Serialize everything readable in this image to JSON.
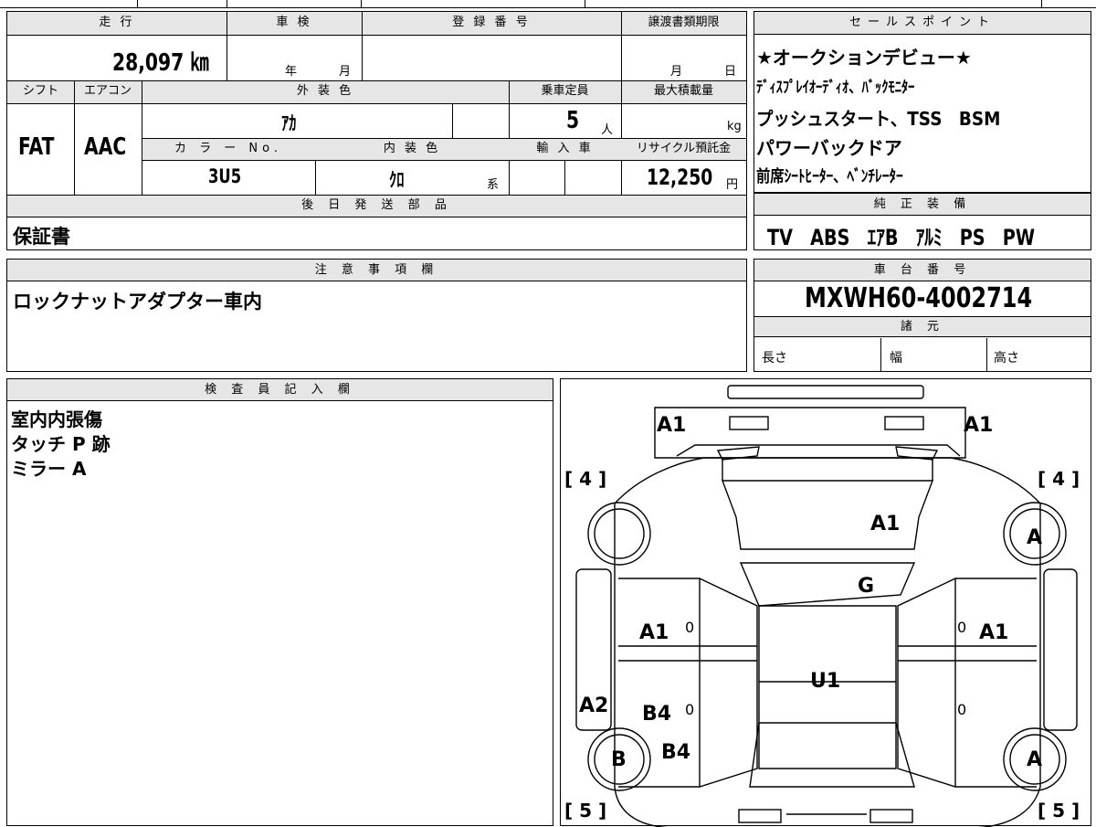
{
  "top": {
    "mileage_label": "走 行",
    "mileage": "28,097 ㎞",
    "inspection_label": "車 検",
    "inspection_year": "年",
    "inspection_month": "月",
    "reg_label": "登 録 番 号",
    "transfer_label": "譲渡書類期限",
    "transfer_month": "月",
    "transfer_day": "日",
    "shift_label": "シフト",
    "shift": "FAT",
    "ac_label": "エアコン",
    "ac": "AAC",
    "ext_color_label": "外 装 色",
    "ext_color": "ｱｶ",
    "capacity_label": "乗車定員",
    "capacity": "5",
    "capacity_unit": "人",
    "max_load_label": "最大積載量",
    "max_load_unit": "kg",
    "color_no_label": "カ ラ ー No.",
    "color_no": "3U5",
    "int_color_label": "内 装 色",
    "int_color": "ｸﾛ",
    "int_color_suffix": "系",
    "import_label": "輸 入 車",
    "recycle_label": "リサイクル預託金",
    "recycle": "12,250",
    "recycle_unit": "円",
    "later_parts_label": "後 日 発 送 部 品",
    "later_parts": "保証書"
  },
  "sales": {
    "label": "セールスポイント",
    "lines": [
      "★オークションデビュー★",
      "ﾃﾞｨｽﾌﾟﾚｲｵｰﾃﾞｨｵ、ﾊﾞｯｸﾓﾆﾀｰ",
      "プッシュスタート、TSS　BSM",
      "パワーバックドア",
      "前席ｼｰﾄﾋｰﾀｰ、ﾍﾞﾝﾁﾚｰﾀｰ"
    ]
  },
  "equipment": {
    "label": "純 正 装 備",
    "value": "TV　ABS　ｴｱB　ｱﾙﾐ　PS　PW"
  },
  "notes": {
    "label": "注 意 事 項 欄",
    "value": "ロックナットアダプター車内"
  },
  "chassis": {
    "label": "車 台 番 号",
    "value": "MXWH60-4002714"
  },
  "specs": {
    "label": "諸 元",
    "length": "長さ",
    "width": "幅",
    "height": "高さ"
  },
  "inspector": {
    "label": "検 査 員 記 入 欄",
    "lines": [
      "室内内張傷",
      "タッチ P 跡",
      "ミラー A"
    ]
  },
  "diagram": {
    "marks": {
      "front_left": "A1",
      "front_right": "A1",
      "hood": "A1",
      "windshield": "G",
      "front_door_left": "A1",
      "front_door_right": "A1",
      "roof": "U1",
      "rear_door_left": "B4",
      "rear_fender_left": "B4",
      "rocker_left": "A2",
      "tire_front_right": "A",
      "tire_rear_left": "B",
      "tire_rear_right": "A",
      "bracket_front_left": "[ 4 ]",
      "bracket_front_right": "[ 4 ]",
      "bracket_rear_left": "[ 5 ]",
      "bracket_rear_right": "[ 5 ]",
      "zero_1": "0",
      "zero_2": "0",
      "zero_3": "0",
      "zero_4": "0"
    }
  }
}
